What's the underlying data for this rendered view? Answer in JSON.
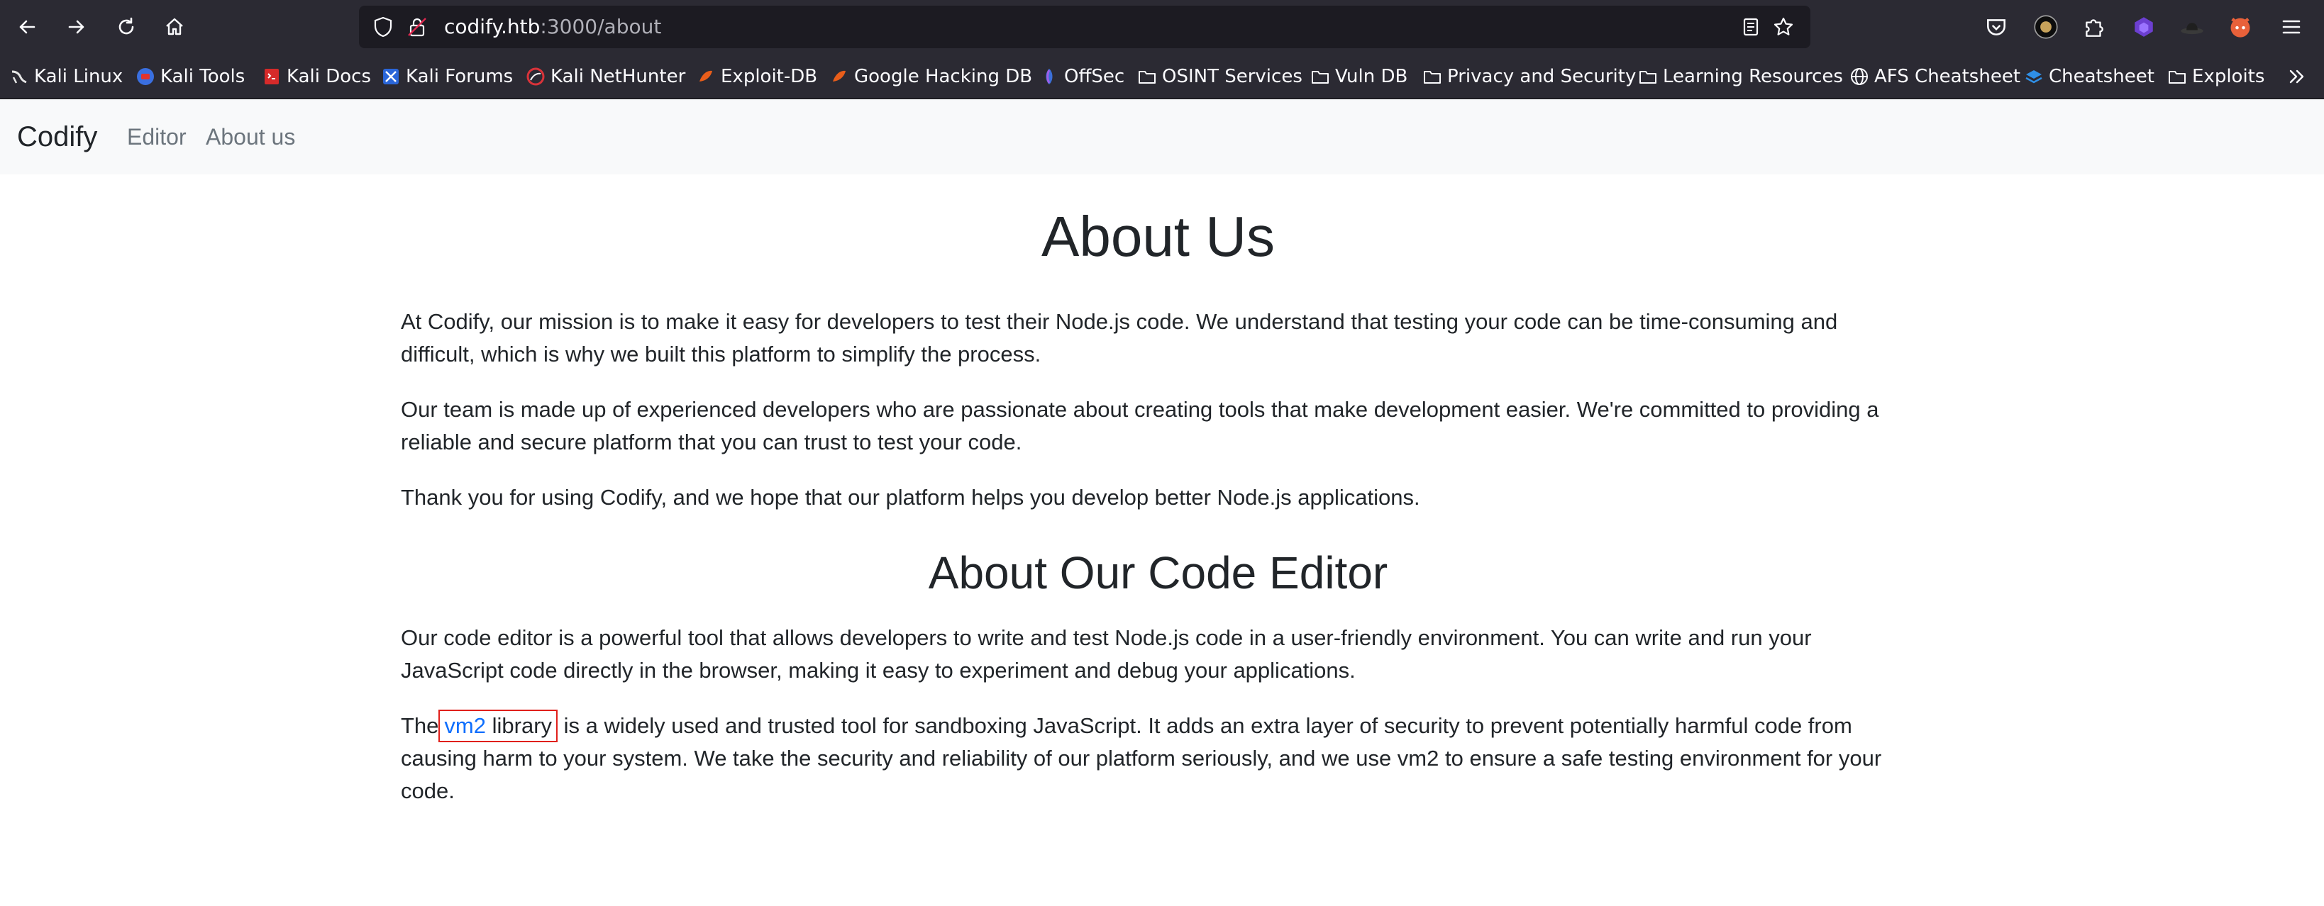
{
  "browser": {
    "url_host": "codify.htb",
    "url_path": ":3000/about",
    "bookmarks": [
      {
        "label": "Kali Linux",
        "icon": "kali-dragon-icon"
      },
      {
        "label": "Kali Tools",
        "icon": "kali-tools-icon"
      },
      {
        "label": "Kali Docs",
        "icon": "kali-docs-icon"
      },
      {
        "label": "Kali Forums",
        "icon": "kali-forums-icon"
      },
      {
        "label": "Kali NetHunter",
        "icon": "nethunter-icon"
      },
      {
        "label": "Exploit-DB",
        "icon": "exploit-db-icon"
      },
      {
        "label": "Google Hacking DB",
        "icon": "ghdb-icon"
      },
      {
        "label": "OffSec",
        "icon": "offsec-icon"
      },
      {
        "label": "OSINT Services",
        "icon": "folder-icon"
      },
      {
        "label": "Vuln DB",
        "icon": "folder-icon"
      },
      {
        "label": "Privacy and Security",
        "icon": "folder-icon"
      },
      {
        "label": "Learning Resources",
        "icon": "folder-icon"
      },
      {
        "label": "AFS Cheatsheet",
        "icon": "globe-icon"
      },
      {
        "label": "Cheatsheet",
        "icon": "cheatsheet-icon"
      },
      {
        "label": "Exploits",
        "icon": "folder-icon"
      }
    ]
  },
  "site": {
    "brand": "Codify",
    "nav": {
      "editor": "Editor",
      "about": "About us"
    }
  },
  "page": {
    "title": "About Us",
    "intro": [
      "At Codify, our mission is to make it easy for developers to test their Node.js code. We understand that testing your code can be time-consuming and difficult, which is why we built this platform to simplify the process.",
      "Our team is made up of experienced developers who are passionate about creating tools that make development easier. We're committed to providing a reliable and secure platform that you can trust to test your code.",
      "Thank you for using Codify, and we hope that our platform helps you develop better Node.js applications."
    ],
    "editor_heading": "About Our Code Editor",
    "editor_para": "Our code editor is a powerful tool that allows developers to write and test Node.js code in a user-friendly environment. You can write and run your JavaScript code directly in the browser, making it easy to experiment and debug your applications.",
    "vm2": {
      "prefix": "The",
      "link_text": "vm2",
      "link_suffix": " library",
      "rest": "is a widely used and trusted tool for sandboxing JavaScript. It adds an extra layer of security to prevent potentially harmful code from causing harm to your system. We take the security and reliability of our platform seriously, and we use vm2 to ensure a safe testing environment for your code."
    }
  },
  "colors": {
    "chrome_bg": "#2b2a33",
    "urlbar_bg": "#1c1b22",
    "navbar_bg": "#f8f9fa",
    "link": "#0d6efd",
    "highlight_box": "#e0201b"
  }
}
